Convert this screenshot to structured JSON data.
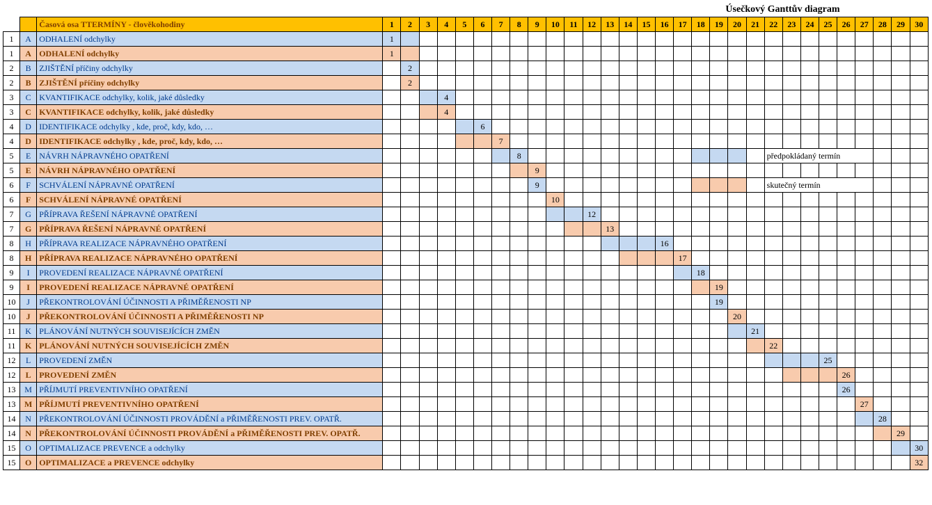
{
  "chart_data": {
    "type": "gantt",
    "title": "Úsečkový Ganttův diagram",
    "x_axis_label": "Časová osa TTERMÍNY - člověkohodiny",
    "xlim": [
      1,
      30
    ],
    "legend": [
      {
        "name": "předpokládaný termín",
        "color": "#C5D9F1"
      },
      {
        "name": "skutečný termín",
        "color": "#F8CBAD"
      }
    ],
    "day_columns": [
      "1",
      "2",
      "3",
      "4",
      "5",
      "6",
      "7",
      "8",
      "9",
      "10",
      "11",
      "12",
      "13",
      "14",
      "15",
      "16",
      "17",
      "18",
      "19",
      "20",
      "21",
      "22",
      "23",
      "24",
      "25",
      "26",
      "27",
      "28",
      "29",
      "30"
    ],
    "tasks": [
      {
        "num": "1",
        "letter": "A",
        "name": "ODHALENÍ odchylky",
        "planned_start": 1,
        "planned_end": 2,
        "planned_label_col": 1,
        "planned_label": "1",
        "actual_start": 1,
        "actual_end": 2,
        "actual_label_col": 1,
        "actual_label": "1",
        "actual_name": "ODHALENÍ odchylky"
      },
      {
        "num": "2",
        "letter": "B",
        "name": "ZJIŠTĚNÍ  příčiny odchylky",
        "planned_start": 2,
        "planned_end": 2,
        "planned_label_col": 2,
        "planned_label": "2",
        "actual_start": 2,
        "actual_end": 2,
        "actual_label_col": 2,
        "actual_label": "2",
        "actual_name": "ZJIŠTĚNÍ  příčiny odchylky"
      },
      {
        "num": "3",
        "letter": "C",
        "name": "KVANTIFIKACE odchylky, kolik, jaké důsledky",
        "planned_start": 3,
        "planned_end": 4,
        "planned_label_col": 4,
        "planned_label": "4",
        "actual_start": 3,
        "actual_end": 4,
        "actual_label_col": 4,
        "actual_label": "4",
        "actual_name": "KVANTIFIKACE odchylky, kolik, jaké důsledky"
      },
      {
        "num": "4",
        "letter": "D",
        "name": "IDENTIFIKACE odchylky , kde, proč, kdy, kdo, …",
        "planned_start": 5,
        "planned_end": 6,
        "planned_label_col": 6,
        "planned_label": "6",
        "actual_start": 5,
        "actual_end": 7,
        "actual_label_col": 7,
        "actual_label": "7",
        "actual_name": "IDENTIFIKACE odchylky , kde, proč, kdy, kdo, …"
      },
      {
        "num": "5",
        "letter": "E",
        "name": "NÁVRH NÁPRAVNÉHO  OPATŘENÍ",
        "planned_start": 7,
        "planned_end": 8,
        "planned_label_col": 8,
        "planned_label": "8",
        "actual_start": 8,
        "actual_end": 9,
        "actual_label_col": 9,
        "actual_label": "9",
        "actual_name": "NÁVRH NÁPRAVNÉHO  OPATŘENÍ",
        "legend_box_start": 18,
        "legend_box_end": 20,
        "legend_text_start": 22,
        "legend_text": "předpokládaný termín"
      },
      {
        "num": "6",
        "letter": "F",
        "name": "SCHVÁLENÍ NÁPRAVNÉ OPATŘENÍ",
        "planned_start": 9,
        "planned_end": 9,
        "planned_label_col": 9,
        "planned_label": "9",
        "actual_start": 10,
        "actual_end": 10,
        "actual_label_col": 10,
        "actual_label": "10",
        "actual_name": "SCHVÁLENÍ NÁPRAVNÉ OPATŘENÍ",
        "legend_box_start": 18,
        "legend_box_end": 20,
        "legend_text_start": 22,
        "legend_text": "skutečný termín"
      },
      {
        "num": "7",
        "letter": "G",
        "name": "PŘÍPRAVA ŘEŠENÍ NÁPRAVNÉ OPATŘENÍ",
        "planned_start": 10,
        "planned_end": 12,
        "planned_label_col": 12,
        "planned_label": "12",
        "actual_start": 11,
        "actual_end": 13,
        "actual_label_col": 13,
        "actual_label": "13",
        "actual_name": "PŘÍPRAVA ŘEŠENÍ NÁPRAVNÉ OPATŘENÍ"
      },
      {
        "num": "8",
        "letter": "H",
        "name": "PŘÍPRAVA REALIZACE NÁPRAVNÉHO OPATŘENÍ",
        "planned_start": 13,
        "planned_end": 16,
        "planned_label_col": 16,
        "planned_label": "16",
        "actual_start": 14,
        "actual_end": 17,
        "actual_label_col": 17,
        "actual_label": "17",
        "actual_name": "PŘÍPRAVA REALIZACE NÁPRAVNÉHO OPATŘENÍ"
      },
      {
        "num": "9",
        "letter": "I",
        "name": "PROVEDENÍ REALIZACE NÁPRAVNÉ OPATŘENÍ",
        "planned_start": 17,
        "planned_end": 18,
        "planned_label_col": 18,
        "planned_label": "18",
        "actual_start": 18,
        "actual_end": 19,
        "actual_label_col": 19,
        "actual_label": "19",
        "actual_name": "PROVEDENÍ REALIZACE NÁPRAVNÉ OPATŘENÍ"
      },
      {
        "num": "10",
        "letter": "J",
        "name": "PŘEKONTROLOVÁNÍ ÚČINNOSTI A PŘIMĚŘENOSTI NP",
        "planned_start": 19,
        "planned_end": 19,
        "planned_label_col": 19,
        "planned_label": "19",
        "actual_start": 20,
        "actual_end": 20,
        "actual_label_col": 20,
        "actual_label": "20",
        "actual_name": "PŘEKONTROLOVÁNÍ ÚČINNOSTI A PŘIMĚŘENOSTI NP"
      },
      {
        "num": "11",
        "letter": "K",
        "name": "PLÁNOVÁNÍ NUTNÝCH SOUVISEJÍCÍCH ZMĚN",
        "planned_start": 20,
        "planned_end": 21,
        "planned_label_col": 21,
        "planned_label": "21",
        "actual_start": 21,
        "actual_end": 22,
        "actual_label_col": 22,
        "actual_label": "22",
        "actual_name": "PLÁNOVÁNÍ NUTNÝCH SOUVISEJÍCÍCH ZMĚN"
      },
      {
        "num": "12",
        "letter": "L",
        "name": "PROVEDENÍ ZMĚN",
        "planned_start": 22,
        "planned_end": 25,
        "planned_label_col": 25,
        "planned_label": "25",
        "actual_start": 23,
        "actual_end": 26,
        "actual_label_col": 26,
        "actual_label": "26",
        "actual_name": "PROVEDENÍ ZMĚN"
      },
      {
        "num": "13",
        "letter": "M",
        "name": "PŘÍJMUTÍ PREVENTIVNÍHO OPATŘENÍ",
        "planned_start": 26,
        "planned_end": 26,
        "planned_label_col": 26,
        "planned_label": "26",
        "actual_start": 27,
        "actual_end": 27,
        "actual_label_col": 27,
        "actual_label": "27",
        "actual_name": "PŘÍJMUTÍ PREVENTIVNÍHO OPATŘENÍ"
      },
      {
        "num": "14",
        "letter": "N",
        "name": "PŘEKONTROLOVÁNÍ ÚČINNOSTI PROVÁDĚNÍ a PŘIMĚŘENOSTI PREV. OPATŘ.",
        "planned_start": 27,
        "planned_end": 28,
        "planned_label_col": 28,
        "planned_label": "28",
        "actual_start": 28,
        "actual_end": 29,
        "actual_label_col": 29,
        "actual_label": "29",
        "actual_name": "PŘEKONTROLOVÁNÍ ÚČINNOSTI PROVÁDĚNÍ a PŘIMĚŘENOSTI PREV. OPATŘ.",
        "task_overflow": true
      },
      {
        "num": "15",
        "letter": "O",
        "name": "OPTIMALIZACE PREVENCE a odchylky",
        "planned_start": 29,
        "planned_end": 30,
        "planned_label_col": 30,
        "planned_label": "30",
        "actual_start": 30,
        "actual_end": 30,
        "actual_label_col": 30,
        "actual_label": "32",
        "actual_name": "OPTIMALIZACE a PREVENCE odchylky"
      }
    ]
  }
}
